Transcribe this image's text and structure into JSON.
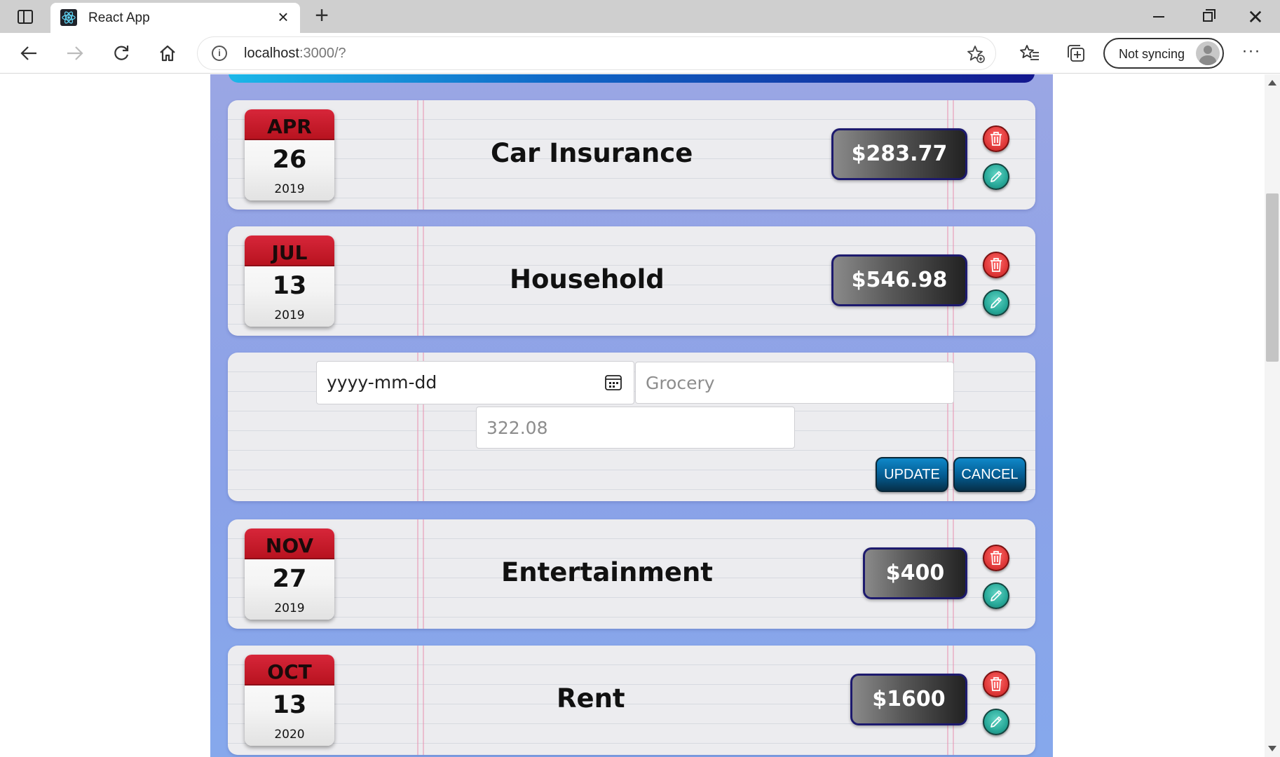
{
  "browser": {
    "tab_title": "React App",
    "url_host": "localhost",
    "url_rest": ":3000/?",
    "sync_label": "Not syncing"
  },
  "expenses": [
    {
      "month": "APR",
      "day": "26",
      "year": "2019",
      "title": "Car Insurance",
      "amount": "$283.77"
    },
    {
      "month": "JUL",
      "day": "13",
      "year": "2019",
      "title": "Household",
      "amount": "$546.98"
    },
    {
      "month": "NOV",
      "day": "27",
      "year": "2019",
      "title": "Entertainment",
      "amount": "$400"
    },
    {
      "month": "OCT",
      "day": "13",
      "year": "2020",
      "title": "Rent",
      "amount": "$1600"
    }
  ],
  "edit_form": {
    "date_placeholder": "yyyy-mm-dd",
    "title_placeholder": "Grocery",
    "amount_placeholder": "322.08",
    "update_label": "UPDATE",
    "cancel_label": "CANCEL"
  },
  "colors": {
    "app_background": "#8aa2e8",
    "calendar_red": "#c8192a",
    "delete_red": "#e03a3a",
    "edit_teal": "#27a898",
    "button_blue": "#045a8f"
  },
  "icons": {
    "delete": "trash-icon",
    "edit": "pencil-icon",
    "date_picker": "calendar-icon"
  }
}
